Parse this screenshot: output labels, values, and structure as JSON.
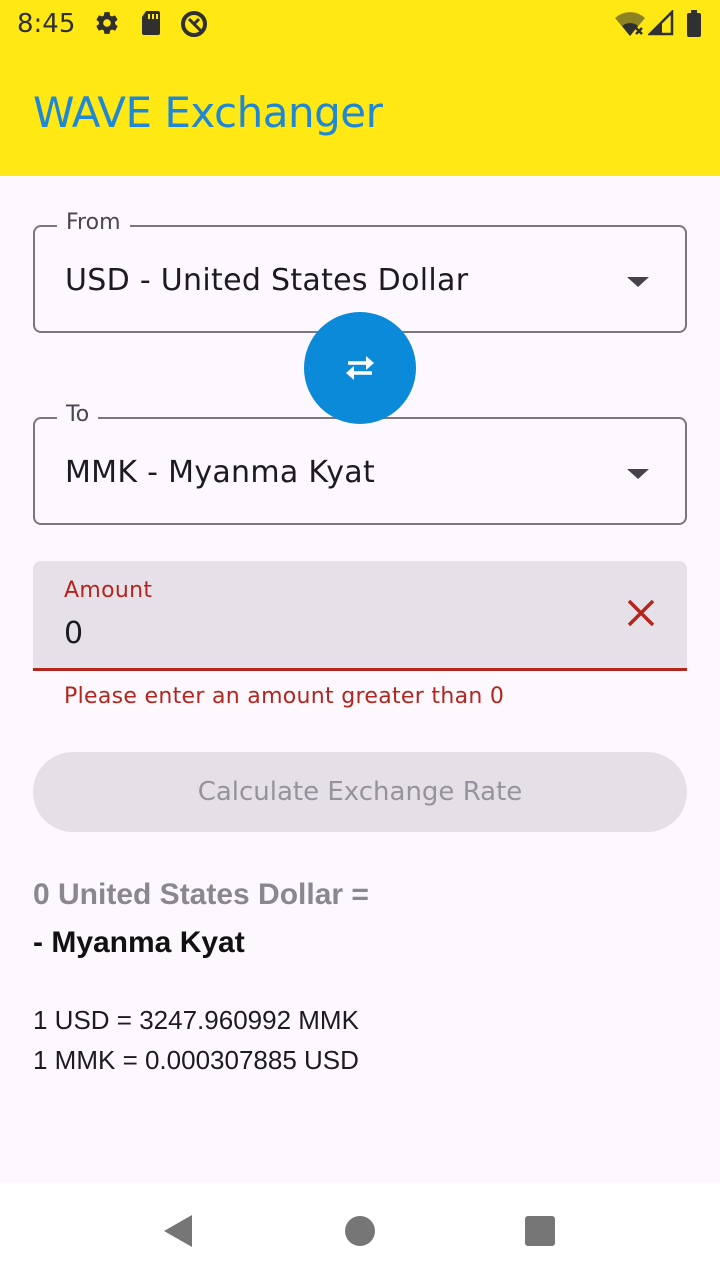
{
  "status_bar": {
    "time": "8:45",
    "icons": [
      "settings-icon",
      "sd-card-icon",
      "do-not-disturb-icon",
      "wifi-off-icon",
      "signal-icon",
      "battery-icon"
    ]
  },
  "app_bar": {
    "title": "WAVE Exchanger",
    "background": "#ffe814",
    "title_color": "#1e88d6"
  },
  "from_field": {
    "label": "From",
    "value": "USD - United States Dollar"
  },
  "to_field": {
    "label": "To",
    "value": "MMK - Myanma Kyat"
  },
  "swap_button": {
    "icon": "swap-horizontal-icon",
    "color": "#0a8ad8"
  },
  "amount_field": {
    "label": "Amount",
    "value": "0",
    "error": "Please enter an amount greater than 0",
    "error_color": "#b3261e"
  },
  "calculate_button": {
    "label": "Calculate Exchange Rate",
    "disabled": true
  },
  "result": {
    "line1": "0 United States Dollar =",
    "line2": "- Myanma Kyat",
    "rate_forward": "1 USD = 3247.960992 MMK",
    "rate_reverse": "1 MMK = 0.000307885 USD"
  },
  "nav_bar": {
    "icons": [
      "back-icon",
      "home-icon",
      "recents-icon"
    ]
  }
}
